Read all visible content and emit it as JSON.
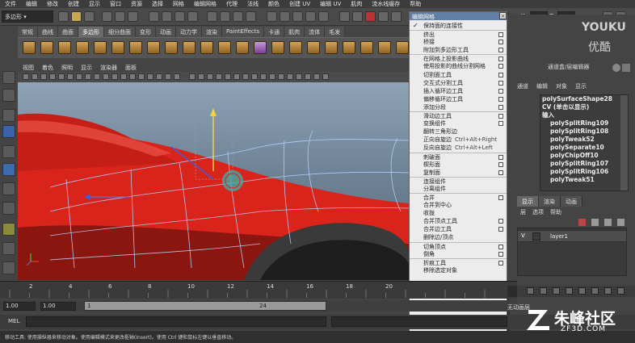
{
  "menubar": [
    "文件",
    "编辑",
    "修改",
    "创建",
    "显示",
    "窗口",
    "资源",
    "选择",
    "网格",
    "编辑网格",
    "代理",
    "法线",
    "颜色",
    "创建 UV",
    "编辑 UV",
    "肌肉",
    "流水线缓存",
    "帮助"
  ],
  "status": {
    "mode": "多边形",
    "axis_y": "Y:",
    "axis_z": "Z:"
  },
  "shelf": {
    "tabs": [
      "常规",
      "曲线",
      "曲面",
      "多边形",
      "细分曲面",
      "变形",
      "动画",
      "动力学",
      "渲染",
      "PaintEffects",
      "卡通",
      "肌肉",
      "流体",
      "毛发"
    ],
    "active": "多边形"
  },
  "viewport": {
    "menu": [
      "视图",
      "着色",
      "照明",
      "显示",
      "渲染器",
      "面板"
    ],
    "car_color": "#d9241b"
  },
  "popup": {
    "title": "编辑网格",
    "items": [
      {
        "label": "保持面的连接性",
        "checked": true,
        "option": false,
        "sep": false
      },
      {
        "label": "挤出",
        "option": true,
        "sep": true
      },
      {
        "label": "桥接",
        "option": true
      },
      {
        "label": "附加到多边形工具",
        "option": true
      },
      {
        "label": "在网格上投影曲线",
        "option": true,
        "sep": true
      },
      {
        "label": "使用投影的曲线分割网格",
        "option": true
      },
      {
        "label": "切割面工具",
        "option": true
      },
      {
        "label": "交互式分割工具",
        "option": true
      },
      {
        "label": "插入循环边工具",
        "option": true
      },
      {
        "label": "偏移循环边工具",
        "option": true
      },
      {
        "label": "添加分段",
        "option": true
      },
      {
        "label": "滑动边工具",
        "option": true,
        "sep": true
      },
      {
        "label": "变换组件",
        "option": true
      },
      {
        "label": "翻转三角形边",
        "option": false
      },
      {
        "label": "正向自旋边",
        "shortcut": "Ctrl+Alt+Right",
        "option": false
      },
      {
        "label": "反向自旋边",
        "shortcut": "Ctrl+Alt+Left",
        "option": false
      },
      {
        "label": "刺破面",
        "option": true,
        "sep": true
      },
      {
        "label": "楔形面",
        "option": true
      },
      {
        "label": "复制面",
        "option": true
      },
      {
        "label": "连接组件",
        "option": false,
        "sep": true
      },
      {
        "label": "分离组件",
        "option": false
      },
      {
        "label": "合并",
        "option": true,
        "sep": true
      },
      {
        "label": "合并到中心",
        "option": false
      },
      {
        "label": "收拢",
        "option": false
      },
      {
        "label": "合并顶点工具",
        "option": true
      },
      {
        "label": "合并边工具",
        "option": true
      },
      {
        "label": "删除边/顶点",
        "option": false
      },
      {
        "label": "切角顶点",
        "option": true,
        "sep": true
      },
      {
        "label": "倒角",
        "option": true
      },
      {
        "label": "折痕工具",
        "option": true,
        "sep": true
      },
      {
        "label": "移除选定对象",
        "option": false
      }
    ]
  },
  "channel_box": {
    "title": "通道盒/层编辑器",
    "menu": [
      "通道",
      "编辑",
      "对象",
      "显示"
    ],
    "items": [
      {
        "label": "polySurfaceShape28",
        "node": false
      },
      {
        "label": "CV (单击以显示)",
        "node": false
      },
      {
        "label": "输入",
        "node": false
      },
      {
        "label": "polySplitRing109",
        "node": true
      },
      {
        "label": "polySplitRing108",
        "node": true
      },
      {
        "label": "polyTweak52",
        "node": true
      },
      {
        "label": "polySeparate10",
        "node": true
      },
      {
        "label": "polyChipOff10",
        "node": true
      },
      {
        "label": "polySplitRing107",
        "node": true
      },
      {
        "label": "polySplitRing106",
        "node": true
      },
      {
        "label": "polyTweak51",
        "node": true
      }
    ]
  },
  "layer_editor": {
    "tabs": [
      "显示",
      "渲染",
      "动画"
    ],
    "menu": [
      "层",
      "选项",
      "帮助"
    ],
    "layer": {
      "visible": "V",
      "name": "layer1"
    }
  },
  "timeline": {
    "ticks": [
      "2",
      "4",
      "6",
      "8",
      "10",
      "12",
      "14",
      "16",
      "18",
      "20"
    ],
    "start": "1.00",
    "range_start": "1.00",
    "range_value": "1",
    "range_end": "24",
    "autokey": "无动画层"
  },
  "cmdline": {
    "label": "MEL"
  },
  "helpline": "移动工具: 使用操纵器来移动对象。使用编辑模式来更改枢轴(Insert)。使用 Ctrl 键和鼠标左键以垂直移动。",
  "watermarks": {
    "youku": "YOUKU",
    "youku_cn": "优酷",
    "zf": "朱峰社区",
    "zf_url": "ZF3D.COM"
  }
}
